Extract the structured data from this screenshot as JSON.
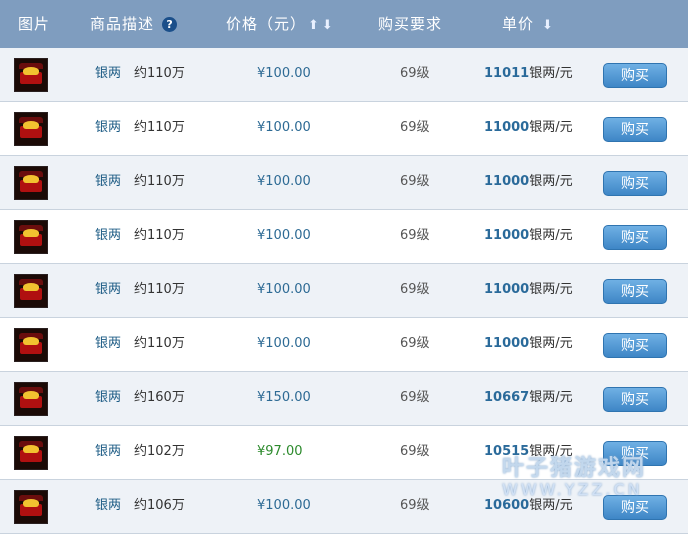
{
  "header": {
    "col_image": "图片",
    "col_desc": "商品描述",
    "col_price": "价格（元）",
    "col_req": "购买要求",
    "col_unit": "单价"
  },
  "rows": [
    {
      "category": "银两",
      "amount": "约110万",
      "price": "¥100.00",
      "level": "69级",
      "unit_num": "11011",
      "unit_suffix": "银两/元",
      "buy": "购买"
    },
    {
      "category": "银两",
      "amount": "约110万",
      "price": "¥100.00",
      "level": "69级",
      "unit_num": "11000",
      "unit_suffix": "银两/元",
      "buy": "购买"
    },
    {
      "category": "银两",
      "amount": "约110万",
      "price": "¥100.00",
      "level": "69级",
      "unit_num": "11000",
      "unit_suffix": "银两/元",
      "buy": "购买"
    },
    {
      "category": "银两",
      "amount": "约110万",
      "price": "¥100.00",
      "level": "69级",
      "unit_num": "11000",
      "unit_suffix": "银两/元",
      "buy": "购买"
    },
    {
      "category": "银两",
      "amount": "约110万",
      "price": "¥100.00",
      "level": "69级",
      "unit_num": "11000",
      "unit_suffix": "银两/元",
      "buy": "购买"
    },
    {
      "category": "银两",
      "amount": "约110万",
      "price": "¥100.00",
      "level": "69级",
      "unit_num": "11000",
      "unit_suffix": "银两/元",
      "buy": "购买"
    },
    {
      "category": "银两",
      "amount": "约160万",
      "price": "¥150.00",
      "level": "69级",
      "unit_num": "10667",
      "unit_suffix": "银两/元",
      "buy": "购买"
    },
    {
      "category": "银两",
      "amount": "约102万",
      "price": "¥97.00",
      "level": "69级",
      "unit_num": "10515",
      "unit_suffix": "银两/元",
      "buy": "购买"
    },
    {
      "category": "银两",
      "amount": "约106万",
      "price": "¥100.00",
      "level": "69级",
      "unit_num": "10600",
      "unit_suffix": "银两/元",
      "buy": "购买"
    }
  ],
  "watermark": {
    "line1": "叶子猪游戏网",
    "line2": "WWW.YZZ.CN"
  },
  "colors": {
    "header_bg": "#7f9dbf",
    "button": "#3e86c6",
    "price_blue": "#2d6a94",
    "price_green": "#2c8a2c"
  }
}
